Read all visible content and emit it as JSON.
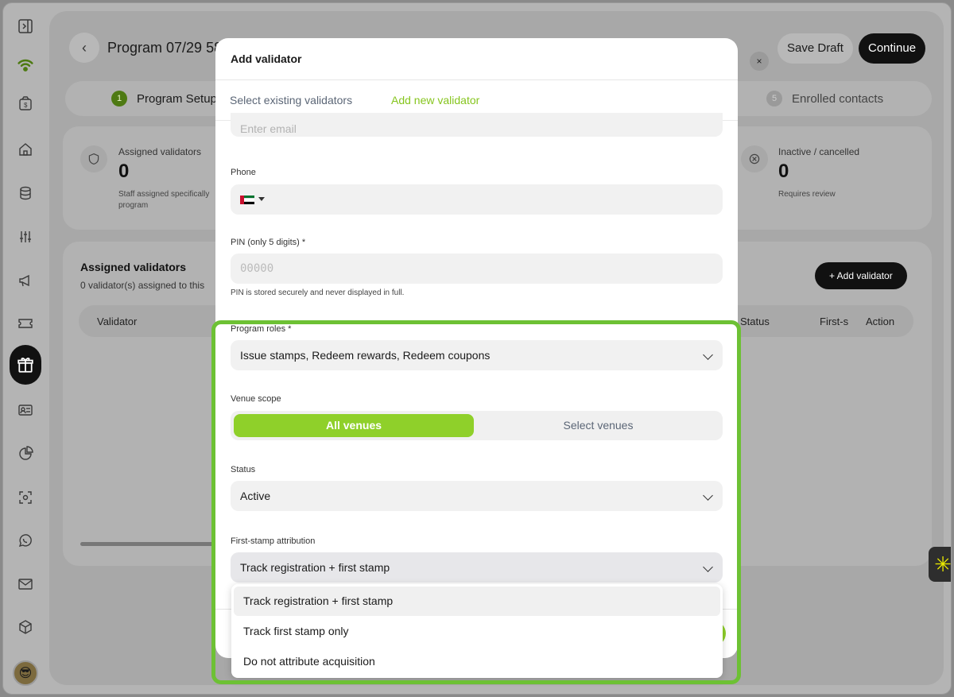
{
  "header": {
    "title": "Program 07/29 585",
    "save_draft_label": "Save Draft",
    "continue_label": "Continue"
  },
  "steps": [
    {
      "number": "1",
      "label": "Program Setup"
    },
    {
      "number": "5",
      "label": "Enrolled contacts"
    }
  ],
  "stats": [
    {
      "label": "Assigned validators",
      "value": "0",
      "sub": "Staff assigned specifically program"
    },
    {
      "label": "Inactive / cancelled",
      "value": "0",
      "sub": "Requires review"
    }
  ],
  "validators": {
    "title": "Assigned validators",
    "subtitle": "0 validator(s) assigned to this",
    "add_label": "+ Add validator",
    "columns": [
      "Validator",
      "Status",
      "First-s",
      "Action"
    ]
  },
  "modal": {
    "title": "Add validator",
    "tabs": [
      "Select existing validators",
      "Add new validator"
    ],
    "active_tab": "Add new validator",
    "email_placeholder": "Enter email",
    "phone_label": "Phone",
    "pin_label": "PIN (only 5 digits) *",
    "pin_placeholder": "00000",
    "pin_help": "PIN is stored securely and never displayed in full.",
    "roles_label": "Program roles *",
    "roles_value": "Issue stamps, Redeem rewards, Redeem coupons",
    "venue_label": "Venue scope",
    "venue_options": [
      "All venues",
      "Select venues"
    ],
    "venue_selected": "All venues",
    "status_label": "Status",
    "status_value": "Active",
    "attribution_label": "First-stamp attribution",
    "attribution_value": "Track registration + first stamp",
    "attribution_options": [
      "Track registration + first stamp",
      "Track first stamp only",
      "Do not attribute acquisition"
    ],
    "close_label": "×"
  },
  "colors": {
    "accent": "#8fd02a",
    "highlight": "#6dc134",
    "dark": "#111111"
  },
  "icons": {
    "widget": "asterisk-icon"
  }
}
